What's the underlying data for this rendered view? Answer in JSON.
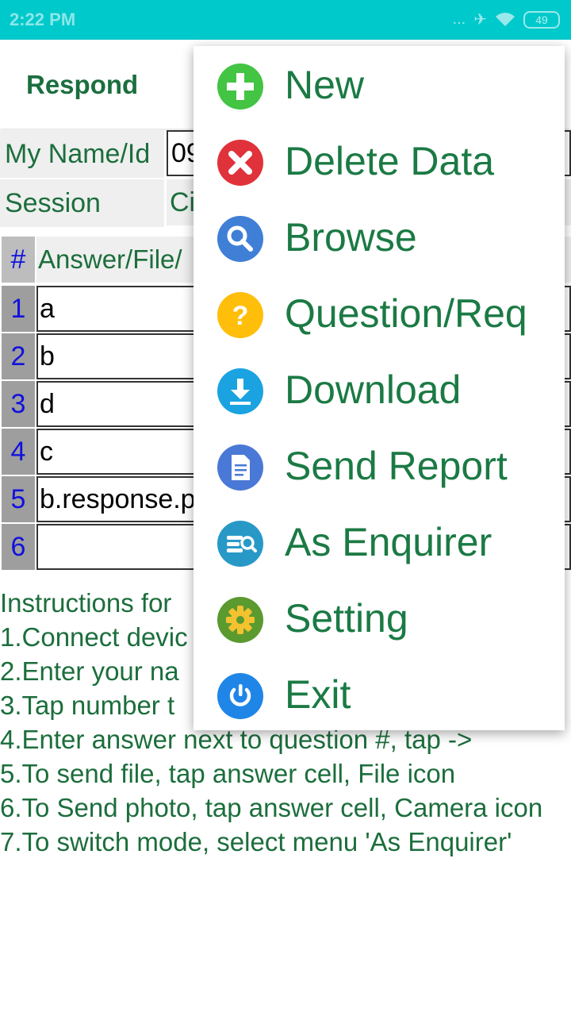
{
  "status_bar": {
    "time": "2:22 PM",
    "signal": "...",
    "battery": "49"
  },
  "app_bar": {
    "title": "Respond"
  },
  "form": {
    "name_label": "My Name/Id",
    "name_value": "09",
    "session_label": "Session",
    "session_value": "Ci"
  },
  "table": {
    "hash_header": "#",
    "answer_header": "Answer/File/",
    "rows": [
      {
        "num": "1",
        "answer": "a"
      },
      {
        "num": "2",
        "answer": "b"
      },
      {
        "num": "3",
        "answer": "d"
      },
      {
        "num": "4",
        "answer": "c"
      },
      {
        "num": "5",
        "answer": "b.response.p"
      },
      {
        "num": "6",
        "answer": ""
      }
    ]
  },
  "instructions": {
    "title": "Instructions for",
    "lines": [
      "1.Connect devic",
      "2.Enter your na",
      "3.Tap number t",
      "4.Enter answer next to question #, tap ->",
      "5.To send file, tap answer cell, File icon",
      "6.To Send photo, tap answer cell, Camera icon",
      "7.To switch mode, select menu 'As Enquirer'"
    ]
  },
  "menu": {
    "items": [
      {
        "label": "New",
        "icon": "add-circle-icon",
        "color": "#43c443"
      },
      {
        "label": "Delete Data",
        "icon": "delete-circle-icon",
        "color": "#e0323a"
      },
      {
        "label": "Browse",
        "icon": "search-icon",
        "color": "#3f7fd6"
      },
      {
        "label": "Question/Req",
        "icon": "question-icon",
        "color": "#ffbe0a"
      },
      {
        "label": "Download",
        "icon": "download-icon",
        "color": "#1aa3e0"
      },
      {
        "label": "Send Report",
        "icon": "document-icon",
        "color": "#4a78d6"
      },
      {
        "label": "As Enquirer",
        "icon": "enquirer-icon",
        "color": "#2899c7"
      },
      {
        "label": "Setting",
        "icon": "gear-icon",
        "color": "#5a9a2e"
      },
      {
        "label": "Exit",
        "icon": "power-icon",
        "color": "#1f86e8"
      }
    ]
  }
}
